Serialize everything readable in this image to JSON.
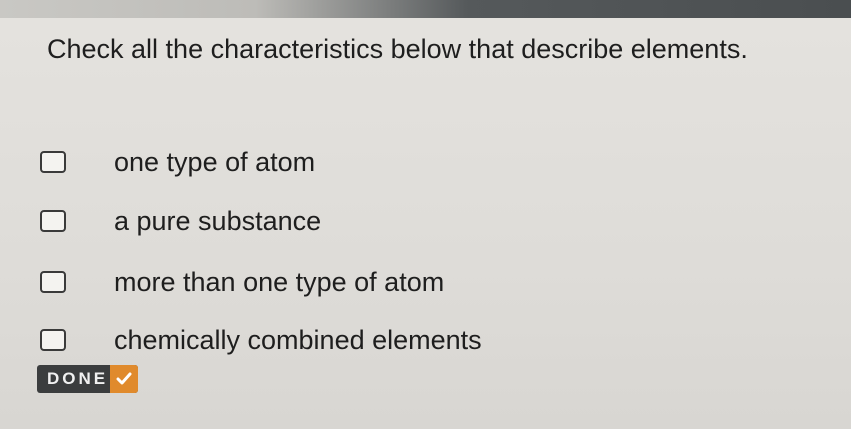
{
  "question": {
    "text": "Check all the characteristics below that describe elements."
  },
  "options": [
    {
      "label": "one type of atom",
      "checked": false
    },
    {
      "label": "a pure substance",
      "checked": false
    },
    {
      "label": "more than one type of atom",
      "checked": false
    },
    {
      "label": "chemically combined elements",
      "checked": false
    }
  ],
  "done_button": {
    "label": "DONE",
    "icon": "check-icon"
  },
  "colors": {
    "accent": "#e08a2c",
    "button_bg": "#3b3d3e",
    "text": "#1e1e1e",
    "background": "#dedcd8"
  }
}
